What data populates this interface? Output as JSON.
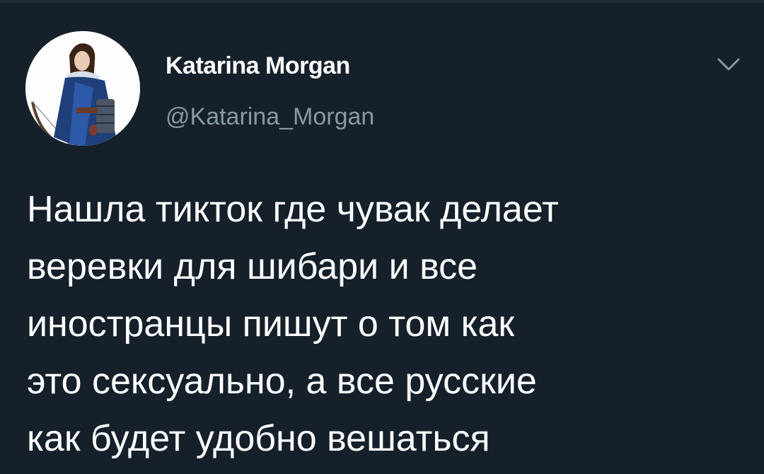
{
  "tweet": {
    "author": {
      "display_name": "Katarina Morgan",
      "handle": "@Katarina_Morgan",
      "avatar_icon": "archer-avatar-icon"
    },
    "menu_icon": "chevron-down-icon",
    "text_lines": [
      "Нашла тикток где чувак делает",
      "веревки для шибари и все",
      "иностранцы пишут о том как",
      "это сексуально, а все русские",
      "как будет удобно вешаться"
    ]
  },
  "colors": {
    "background": "#15202b",
    "text_primary": "#ffffff",
    "text_secondary": "#8899a6"
  }
}
